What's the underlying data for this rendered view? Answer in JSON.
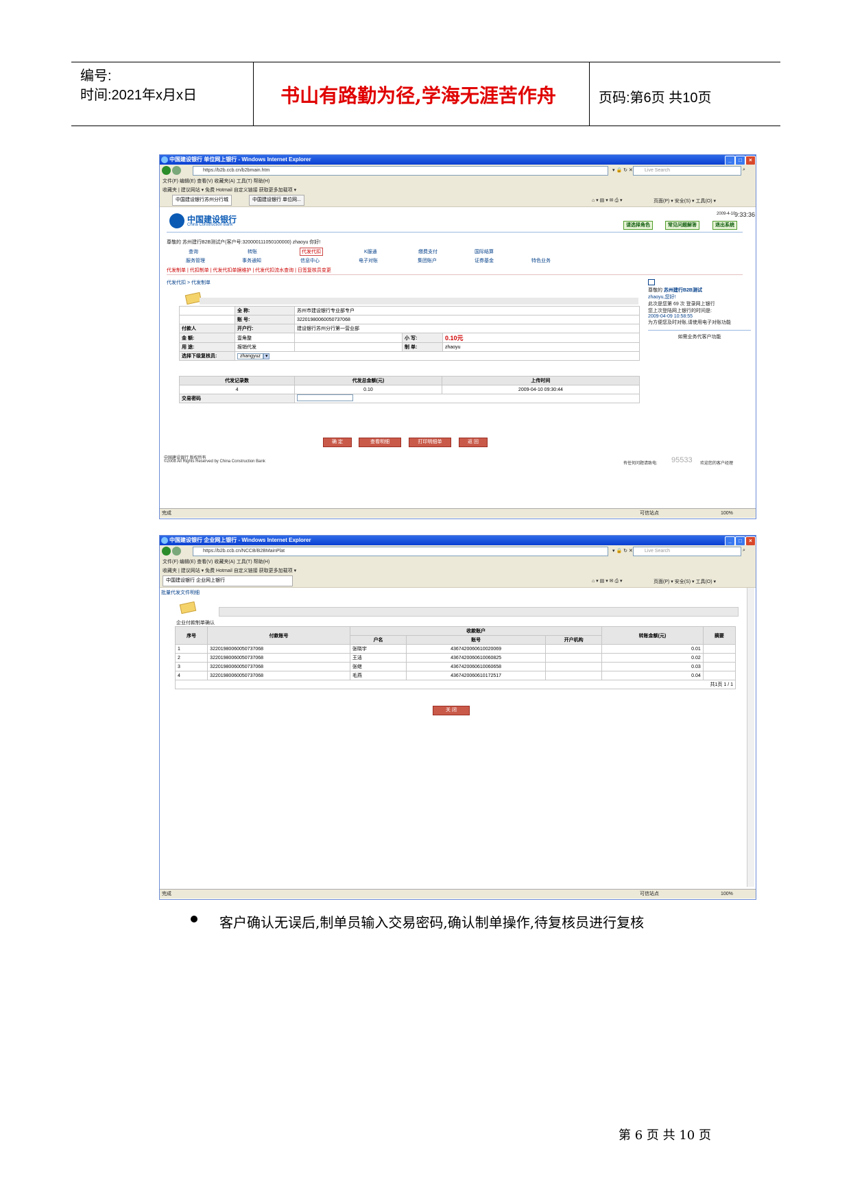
{
  "header": {
    "number_label": "编号:",
    "time_label": "时间:2021年x月x日",
    "motto": "书山有路勤为径,学海无涯苦作舟",
    "page_label": "页码:第6页 共10页"
  },
  "window1": {
    "title": "中国建设银行 单位网上银行 - Windows Internet Explorer",
    "address": "https://b2b.ccb.cn/b2bmain.htm",
    "search_placeholder": "Live Search",
    "menu_bar": "文件(F)  编辑(E)  查看(V)  收藏夹(A)  工具(T)  帮助(H)",
    "favorites_bar": "收藏夹   |  建议网站 ▾   免费 Hotmail   自定义链接   获取更多加载项 ▾",
    "tab1": "中国建设银行苏州分行城",
    "tab2": "中国建设银行 单位网...",
    "ie_tools": "页面(P) ▾  安全(S) ▾  工具(O) ▾",
    "datetime_small": "2009-4-10",
    "time": "9:33:36",
    "bank_name": "中国建设银行",
    "bank_en": "China Construction Bank",
    "role_select": "请选择角色",
    "faq_btn": "常见问题解答",
    "logout_btn": "退出系统",
    "welcome": "尊敬的 苏州建行B2B测试户(客户号:320000111050100000) zhaoyu 你好!",
    "menu_row1": [
      "查询",
      "转账",
      "代发代扣",
      "K服通",
      "缴费支付",
      "国际结算"
    ],
    "menu_row2": [
      "服务管理",
      "事务通知",
      "信息中心",
      "电子对账",
      "集团账户",
      "证券基金",
      "特色业务"
    ],
    "sublinks": "代发制单 | 代扣制单 | 代发代扣单据维护 | 代发代扣流水查询 | 日签复核员变更",
    "breadcrumb": "代发代扣 > 代发制单",
    "form": {
      "payer_label": "付款人",
      "fullname_label": "全 称:",
      "fullname_value": "苏州市建设银行专业部专户",
      "account_label": "账 号:",
      "account_value": "32201980060050737068",
      "bank_label": "开户行:",
      "bank_value": "建设银行苏州分行第一营业部",
      "amount_label": "金 额:",
      "amount_value": "壹角整",
      "lower_label": "小 写:",
      "lower_value": "0.10元",
      "usage_label": "用 途:",
      "usage_value": "报销代发",
      "maker_label": "制 单:",
      "maker_value": "zhaoyu",
      "reviewer_label": "选择下级复核员:",
      "reviewer_value": "zhangyuz"
    },
    "summary_headers": [
      "代发记录数",
      "代发总金额(元)",
      "上传时间"
    ],
    "summary_values": [
      "4",
      "0.10",
      "2009-04-10 09:30:44"
    ],
    "password_label": "交易密码",
    "buttons": [
      "确 定",
      "查看明细",
      "打印明细单",
      "返 回"
    ],
    "sidebar": {
      "greeting_pre": "尊敬的",
      "company": "苏州建行B2B测试",
      "user": "zhaoyu,您好!",
      "visit_line": "此次是您第 69 次 登录网上银行",
      "last_label": "您上次登陆网上银行的时间是:",
      "last_time": "2009-04-09 10:58:55",
      "tip": "为方便您及时对账,请使用电子对账功能",
      "custom_link": "如需业务代客户功能"
    },
    "copyright_cn": "中国建设银行 版权所有",
    "copyright_en": "©2008 All Rights Reserved by China Construction Bank",
    "hotline_pre": "有任何问题请致电:",
    "hotline": "95533",
    "hotline_post": "欢迎您的客户经理",
    "status_done": "完成",
    "status_zone": "可信站点",
    "zoom": "100%"
  },
  "window2": {
    "title": "中国建设银行 企业网上银行 - Windows Internet Explorer",
    "address": "https://b2b.ccb.cn/NCCB/B2BMainPlat",
    "search_placeholder": "Live Search",
    "menu_bar": "文件(F)  编辑(E)  查看(V)  收藏夹(A)  工具(T)  帮助(H)",
    "favorites_bar": "收藏夹   |  建议网站 ▾   免费 Hotmail   自定义链接   获取更多加载项 ▾",
    "tab1": "中国建设银行 企业网上银行",
    "ie_tools": "页面(P) ▾  安全(S) ▾  工具(O) ▾",
    "page_title": "批量代发文件明细",
    "section": "企业付款制单确认",
    "col_headers": [
      "序号",
      "付款账号",
      "收款账户",
      "户名",
      "账号",
      "开户机构",
      "转账金额(元)",
      "摘要"
    ],
    "rows": [
      [
        "1",
        "32201980060050737068",
        "张晓宇",
        "4367420060610020069",
        "",
        "0.01",
        ""
      ],
      [
        "2",
        "32201980060050737068",
        "王洁",
        "4367420060610060825",
        "",
        "0.02",
        ""
      ],
      [
        "3",
        "32201980060050737068",
        "张继",
        "4367420060610060658",
        "",
        "0.03",
        ""
      ],
      [
        "4",
        "32201980060050737068",
        "毛燕",
        "4367420060610172517",
        "",
        "0.04",
        ""
      ]
    ],
    "pager": "共1页  1 / 1",
    "close_button": "关 闭",
    "status_done": "完成",
    "status_zone": "可信站点",
    "zoom": "100%"
  },
  "bullet_text": "客户确认无误后,制单员输入交易密码,确认制单操作,待复核员进行复核",
  "footer": "第 6 页 共 10 页"
}
